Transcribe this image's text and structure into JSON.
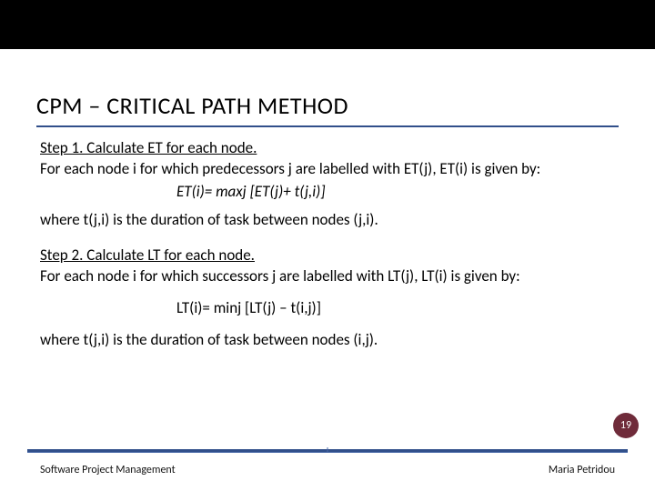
{
  "title": "CPM – CRITICAL PATH METHOD",
  "step1": {
    "label": "Step 1. Calculate ET for each node.",
    "desc": "For each node i for which predecessors j are labelled with ET(j), ET(i) is given by:",
    "formula": "ET(i)= maxj [ET(j)+ t(j,i)]",
    "where": "where t(j,i) is the duration of task between nodes (j,i)."
  },
  "step2": {
    "label": "Step 2. Calculate LT for each node.",
    "desc": "For each node i for which successors j are labelled with LT(j), LT(i) is given by:",
    "formula": "LT(i)= minj [LT(j) – t(i,j)]",
    "where": "where t(j,i) is the duration of task between nodes (i,j)."
  },
  "page_number": "19",
  "footer_left": "Software Project Management",
  "footer_right": "Maria Petridou"
}
